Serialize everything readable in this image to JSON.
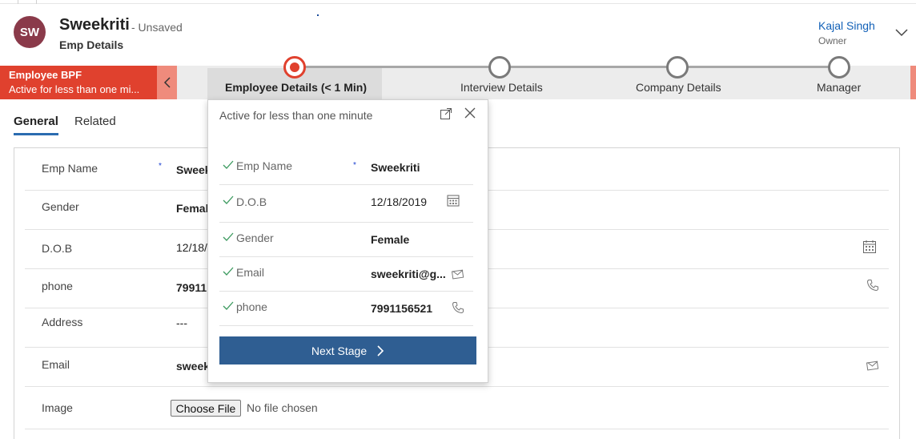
{
  "record": {
    "initials": "SW",
    "title": "Sweekriti",
    "status": "- Unsaved",
    "form_name": "Emp Details"
  },
  "owner": {
    "name": "Kajal Singh",
    "label": "Owner"
  },
  "bpf": {
    "name": "Employee BPF",
    "subtitle": "Active for less than one mi...",
    "stages": [
      {
        "label": "Employee Details  (< 1 Min)",
        "active": true
      },
      {
        "label": "Interview Details",
        "active": false
      },
      {
        "label": "Company Details",
        "active": false
      },
      {
        "label": "Manager",
        "active": false
      }
    ]
  },
  "tabs": [
    {
      "label": "General",
      "active": true
    },
    {
      "label": "Related",
      "active": false
    }
  ],
  "form": {
    "rows": [
      {
        "label": "Emp Name",
        "value": "Sweek"
      },
      {
        "label": "Gender",
        "value": "Femal"
      },
      {
        "label": "D.O.B",
        "value": "12/18/"
      },
      {
        "label": "phone",
        "value": "79911"
      },
      {
        "label": "Address",
        "value": "---"
      },
      {
        "label": "Email",
        "value": "sweek"
      },
      {
        "label": "Image",
        "value": ""
      }
    ],
    "file_button": "Choose File",
    "file_status": "No file chosen",
    "required_marker": "*"
  },
  "flyout": {
    "status": "Active for less than one minute",
    "fields": [
      {
        "label": "Emp Name",
        "value": "Sweekriti"
      },
      {
        "label": "D.O.B",
        "value": "12/18/2019"
      },
      {
        "label": "Gender",
        "value": "Female"
      },
      {
        "label": "Email",
        "value": "sweekriti@g..."
      },
      {
        "label": "phone",
        "value": "7991156521"
      }
    ],
    "required_marker": "*",
    "next_button": "Next Stage"
  },
  "icons": {
    "calendar": "calendar-icon",
    "phone": "phone-icon",
    "email": "email-icon",
    "check": "check-icon",
    "expand": "expand-icon",
    "close": "close-icon",
    "chevron_left": "chevron-left-icon",
    "chevron_right": "chevron-right-icon",
    "chevron_down": "chevron-down-icon"
  },
  "colors": {
    "bpf_active": "#e0412e",
    "bpf_collapse": "#ef8b7c",
    "primary_button": "#2f5e92",
    "link": "#1160b7",
    "avatar": "#8a3a4a",
    "checkmark": "#3c9a5f"
  }
}
